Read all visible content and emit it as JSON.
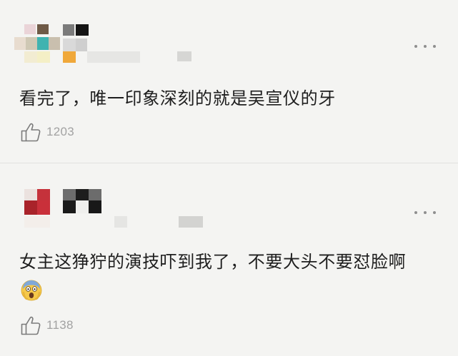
{
  "comments": [
    {
      "text": "看完了，唯一印象深刻的就是吴宣仪的牙",
      "likes": "1203",
      "emoji": "",
      "avatar_icon": "pixelated-avatar",
      "more_icon": "more-dots-icon",
      "like_icon": "thumbs-up-icon"
    },
    {
      "text": "女主这狰狞的演技吓到我了，不要大头不要怼脸啊",
      "likes": "1138",
      "emoji": "screaming-face-emoji",
      "avatar_icon": "pixelated-avatar",
      "more_icon": "more-dots-icon",
      "like_icon": "thumbs-up-icon"
    }
  ],
  "colors": {
    "background": "#f4f4f2",
    "divider": "#e2e2df",
    "text": "#1e1e1e",
    "muted": "#a2a2a2"
  }
}
